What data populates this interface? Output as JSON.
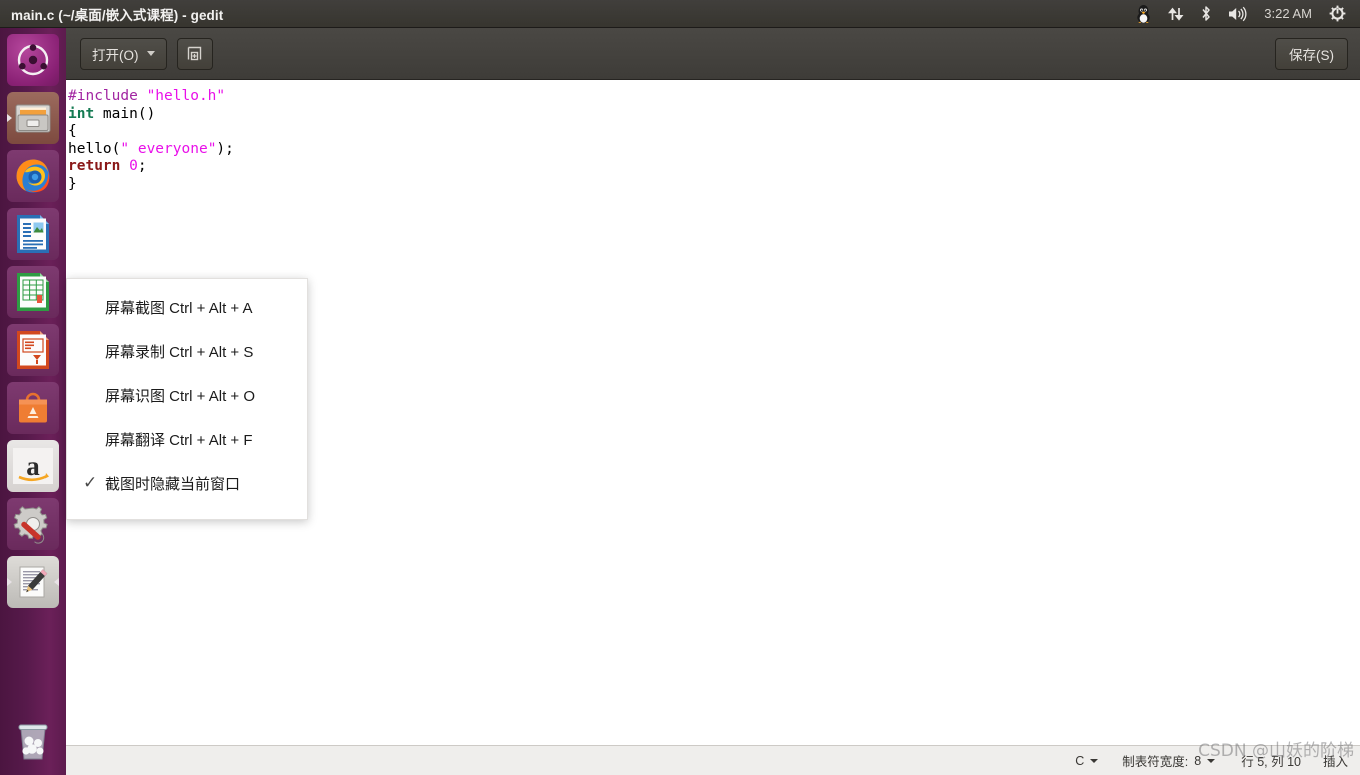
{
  "top_panel": {
    "window_title": "main.c (~/桌面/嵌入式课程) - gedit",
    "tray": {
      "tux_icon": "tux-penguin-icon",
      "network_icon": "network-updown-icon",
      "bluetooth_icon": "bluetooth-icon",
      "volume_icon": "volume-icon",
      "clock": "3:22 AM",
      "session_icon": "session-power-icon"
    }
  },
  "launcher": {
    "items": [
      {
        "name": "ubuntu-dash",
        "icon": "ubuntu-logo-icon",
        "active": false
      },
      {
        "name": "files",
        "icon": "file-manager-icon",
        "active": true
      },
      {
        "name": "firefox",
        "icon": "firefox-icon",
        "active": false
      },
      {
        "name": "libreoffice-writer",
        "icon": "writer-document-icon",
        "active": false
      },
      {
        "name": "libreoffice-calc",
        "icon": "calc-spreadsheet-icon",
        "active": false
      },
      {
        "name": "libreoffice-impress",
        "icon": "impress-presentation-icon",
        "active": false
      },
      {
        "name": "ubuntu-software",
        "icon": "software-bag-icon",
        "active": false
      },
      {
        "name": "amazon",
        "icon": "amazon-a-icon",
        "active": false
      },
      {
        "name": "system-settings",
        "icon": "gear-wrench-icon",
        "active": false
      },
      {
        "name": "gedit",
        "icon": "gedit-pencil-icon",
        "active": true
      }
    ],
    "trash": {
      "name": "trash",
      "icon": "trash-bin-icon"
    }
  },
  "headerbar": {
    "open_label": "打开(O)",
    "new_document_icon": "new-document-icon",
    "save_label": "保存(S)"
  },
  "editor": {
    "lines": [
      [
        {
          "t": "#include ",
          "c": "k-pre"
        },
        {
          "t": "\"hello.h\"",
          "c": "k-str"
        }
      ],
      [
        {
          "t": "int",
          "c": "k-type"
        },
        {
          "t": " main()",
          "c": "k-plain"
        }
      ],
      [
        {
          "t": "{",
          "c": "k-plain"
        }
      ],
      [
        {
          "t": "hello(",
          "c": "k-plain"
        },
        {
          "t": "\" everyone\"",
          "c": "k-str"
        },
        {
          "t": ");",
          "c": "k-plain"
        }
      ],
      [
        {
          "t": "return",
          "c": "k-ret"
        },
        {
          "t": " ",
          "c": "k-plain"
        },
        {
          "t": "0",
          "c": "k-num"
        },
        {
          "t": ";",
          "c": "k-plain"
        }
      ],
      [
        {
          "t": "}",
          "c": "k-plain"
        }
      ]
    ]
  },
  "statusbar": {
    "language": "C",
    "tab_width_label": "制表符宽度:",
    "tab_width_value": "8",
    "position": "行 5, 列 10",
    "insert_mode": "插入"
  },
  "screenshot_menu": {
    "items": [
      {
        "label": "屏幕截图 Ctrl + Alt + A",
        "checked": false
      },
      {
        "label": "屏幕录制 Ctrl + Alt + S",
        "checked": false
      },
      {
        "label": "屏幕识图 Ctrl + Alt + O",
        "checked": false
      },
      {
        "label": "屏幕翻译 Ctrl + Alt + F",
        "checked": false
      },
      {
        "label": "截图时隐藏当前窗口",
        "checked": true
      }
    ],
    "check_glyph": "✓"
  },
  "watermark": {
    "text": "CSDN @山妖的阶梯"
  },
  "colors": {
    "launcher_bg": "#5d1b4e",
    "panel_bg": "#37352f",
    "headerbar_bg": "#413f3b",
    "editor_bg": "#ffffff",
    "statusbar_bg": "#efeeec",
    "string": "#e910e9",
    "preproc": "#a226a2",
    "type_keyword": "#147a52",
    "return_keyword": "#8a1818"
  }
}
